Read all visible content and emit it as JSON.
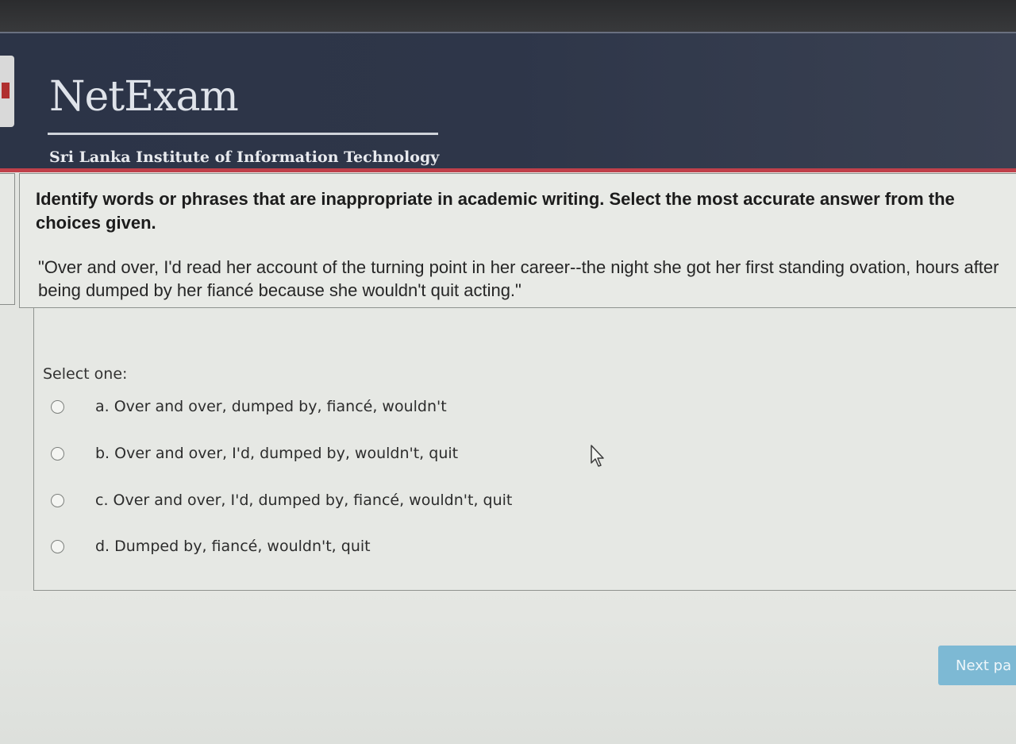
{
  "header": {
    "brand": "NetExam",
    "institute": "Sri Lanka Institute of Information Technology"
  },
  "question": {
    "prompt": "Identify words or phrases that are inappropriate in academic writing. Select the most accurate answer from the choices given.",
    "quote": "\"Over and over, I'd read her account of the turning point in her career--the night she got her first standing ovation, hours after being dumped by her fiancé because she wouldn't quit acting.\"",
    "select_label": "Select one:",
    "options": [
      {
        "label": "a. Over and over, dumped by, fiancé, wouldn't"
      },
      {
        "label": "b. Over and over, I'd, dumped by, wouldn't, quit"
      },
      {
        "label": "c. Over and over, I'd, dumped by, fiancé, wouldn't, quit"
      },
      {
        "label": "d. Dumped by, fiancé, wouldn't, quit"
      }
    ]
  },
  "footer": {
    "next_label": "Next pa"
  },
  "colors": {
    "header_bg": "#2e3649",
    "header_accent": "#c0404a",
    "next_button": "#7db9d4"
  }
}
